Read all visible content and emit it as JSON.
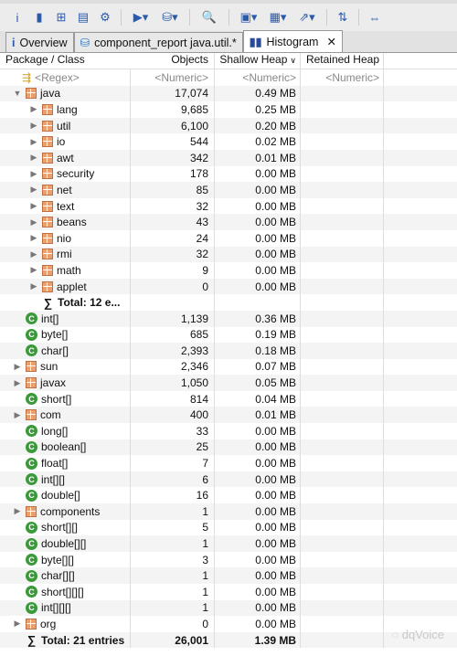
{
  "toolbar": {
    "icons": [
      "info-icon",
      "histogram-icon",
      "dominator-tree-icon",
      "oql-icon",
      "settings-icon",
      "query-browser-icon",
      "heap-dump-icon",
      "search-icon",
      "group-icon",
      "calculator-icon",
      "export-icon",
      "compare-icon",
      "layout-icon"
    ]
  },
  "tabs": [
    {
      "label": "Overview",
      "icon": "info-icon"
    },
    {
      "label": "component_report java.util.*",
      "icon": "heap-icon"
    },
    {
      "label": "Histogram",
      "icon": "histogram-icon",
      "active": true
    }
  ],
  "columns": [
    "Package / Class",
    "Objects",
    "Shallow Heap",
    "Retained Heap"
  ],
  "filter": {
    "name": "<Regex>",
    "objects": "<Numeric>",
    "shallow": "<Numeric>",
    "retained": "<Numeric>"
  },
  "rows": [
    {
      "name": "java",
      "objects": "17,074",
      "shallow": "0.49 MB",
      "type": "package",
      "level": 0,
      "toggle": "expanded"
    },
    {
      "name": "lang",
      "objects": "9,685",
      "shallow": "0.25 MB",
      "type": "package",
      "level": 1,
      "toggle": "collapsed"
    },
    {
      "name": "util",
      "objects": "6,100",
      "shallow": "0.20 MB",
      "type": "package",
      "level": 1,
      "toggle": "collapsed"
    },
    {
      "name": "io",
      "objects": "544",
      "shallow": "0.02 MB",
      "type": "package",
      "level": 1,
      "toggle": "collapsed"
    },
    {
      "name": "awt",
      "objects": "342",
      "shallow": "0.01 MB",
      "type": "package",
      "level": 1,
      "toggle": "collapsed"
    },
    {
      "name": "security",
      "objects": "178",
      "shallow": "0.00 MB",
      "type": "package",
      "level": 1,
      "toggle": "collapsed"
    },
    {
      "name": "net",
      "objects": "85",
      "shallow": "0.00 MB",
      "type": "package",
      "level": 1,
      "toggle": "collapsed"
    },
    {
      "name": "text",
      "objects": "32",
      "shallow": "0.00 MB",
      "type": "package",
      "level": 1,
      "toggle": "collapsed"
    },
    {
      "name": "beans",
      "objects": "43",
      "shallow": "0.00 MB",
      "type": "package",
      "level": 1,
      "toggle": "collapsed"
    },
    {
      "name": "nio",
      "objects": "24",
      "shallow": "0.00 MB",
      "type": "package",
      "level": 1,
      "toggle": "collapsed"
    },
    {
      "name": "rmi",
      "objects": "32",
      "shallow": "0.00 MB",
      "type": "package",
      "level": 1,
      "toggle": "collapsed"
    },
    {
      "name": "math",
      "objects": "9",
      "shallow": "0.00 MB",
      "type": "package",
      "level": 1,
      "toggle": "collapsed"
    },
    {
      "name": "applet",
      "objects": "0",
      "shallow": "0.00 MB",
      "type": "package",
      "level": 1,
      "toggle": "collapsed"
    },
    {
      "name": "Total: 12 e...",
      "objects": "",
      "shallow": "",
      "type": "total",
      "level": 1
    },
    {
      "name": "int[]",
      "objects": "1,139",
      "shallow": "0.36 MB",
      "type": "class",
      "level": 0
    },
    {
      "name": "byte[]",
      "objects": "685",
      "shallow": "0.19 MB",
      "type": "class",
      "level": 0
    },
    {
      "name": "char[]",
      "objects": "2,393",
      "shallow": "0.18 MB",
      "type": "class",
      "level": 0
    },
    {
      "name": "sun",
      "objects": "2,346",
      "shallow": "0.07 MB",
      "type": "package",
      "level": 0,
      "toggle": "collapsed"
    },
    {
      "name": "javax",
      "objects": "1,050",
      "shallow": "0.05 MB",
      "type": "package",
      "level": 0,
      "toggle": "collapsed"
    },
    {
      "name": "short[]",
      "objects": "814",
      "shallow": "0.04 MB",
      "type": "class",
      "level": 0
    },
    {
      "name": "com",
      "objects": "400",
      "shallow": "0.01 MB",
      "type": "package",
      "level": 0,
      "toggle": "collapsed"
    },
    {
      "name": "long[]",
      "objects": "33",
      "shallow": "0.00 MB",
      "type": "class",
      "level": 0
    },
    {
      "name": "boolean[]",
      "objects": "25",
      "shallow": "0.00 MB",
      "type": "class",
      "level": 0
    },
    {
      "name": "float[]",
      "objects": "7",
      "shallow": "0.00 MB",
      "type": "class",
      "level": 0
    },
    {
      "name": "int[][]",
      "objects": "6",
      "shallow": "0.00 MB",
      "type": "class",
      "level": 0
    },
    {
      "name": "double[]",
      "objects": "16",
      "shallow": "0.00 MB",
      "type": "class",
      "level": 0
    },
    {
      "name": "components",
      "objects": "1",
      "shallow": "0.00 MB",
      "type": "package",
      "level": 0,
      "toggle": "collapsed"
    },
    {
      "name": "short[][]",
      "objects": "5",
      "shallow": "0.00 MB",
      "type": "class",
      "level": 0
    },
    {
      "name": "double[][]",
      "objects": "1",
      "shallow": "0.00 MB",
      "type": "class",
      "level": 0
    },
    {
      "name": "byte[][]",
      "objects": "3",
      "shallow": "0.00 MB",
      "type": "class",
      "level": 0
    },
    {
      "name": "char[][]",
      "objects": "1",
      "shallow": "0.00 MB",
      "type": "class",
      "level": 0
    },
    {
      "name": "short[][][]",
      "objects": "1",
      "shallow": "0.00 MB",
      "type": "class",
      "level": 0
    },
    {
      "name": "int[][][]",
      "objects": "1",
      "shallow": "0.00 MB",
      "type": "class",
      "level": 0
    },
    {
      "name": "org",
      "objects": "0",
      "shallow": "0.00 MB",
      "type": "package",
      "level": 0,
      "toggle": "collapsed"
    },
    {
      "name": "Total: 21 entries",
      "objects": "26,001",
      "shallow": "1.39 MB",
      "type": "total",
      "level": 0
    }
  ],
  "watermark": "dqVoice"
}
